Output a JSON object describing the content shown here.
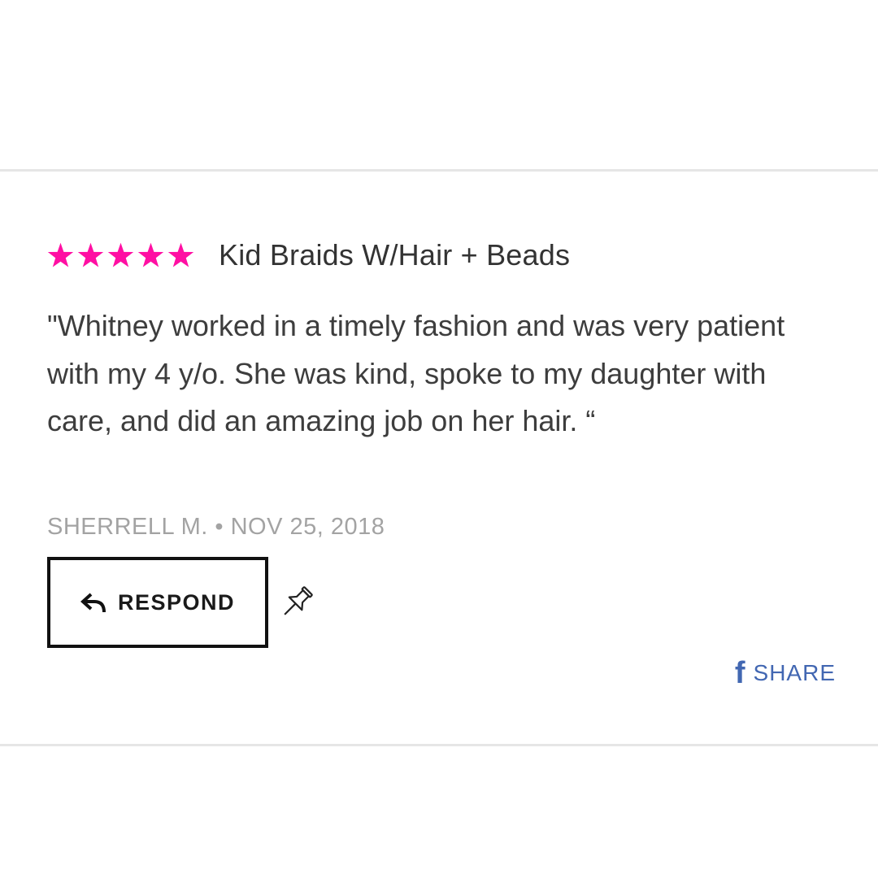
{
  "colors": {
    "star": "#ff0fa3",
    "share": "#4267b2",
    "divider": "#e6e6e6"
  },
  "review": {
    "rating": 5,
    "rating_max": 5,
    "service": "Kid Braids W/Hair + Beads",
    "text": "\"Whitney worked in a timely fashion and was very patient with my 4 y/o. She was kind, spoke to my daughter with care, and did an amazing job on her hair. “",
    "author": "SHERRELL M.",
    "separator": "•",
    "date": "NOV 25, 2018"
  },
  "actions": {
    "respond_label": "RESPOND",
    "respond_icon": "reply-arrow-icon",
    "pin_icon": "pin-icon",
    "share_label": "SHARE",
    "share_icon": "facebook-icon",
    "share_icon_glyph": "f"
  }
}
